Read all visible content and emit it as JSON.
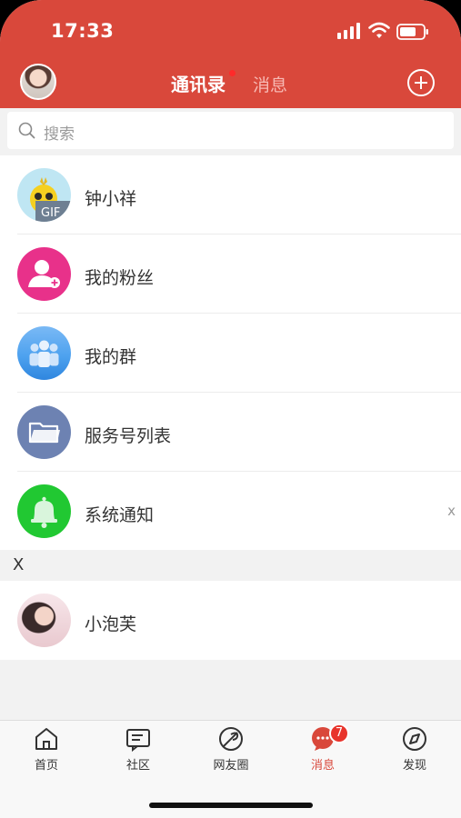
{
  "status_bar": {
    "time": "17:33"
  },
  "header": {
    "tab_contacts": "通讯录",
    "tab_messages": "消息"
  },
  "search": {
    "placeholder": "搜索"
  },
  "rows": [
    {
      "label": "钟小祥",
      "icon": "gif-avatar-icon",
      "badge_text": "GIF",
      "color": "#bfe6f3"
    },
    {
      "label": "我的粉丝",
      "icon": "followers-icon",
      "color": "#e8318a"
    },
    {
      "label": "我的群",
      "icon": "groups-icon",
      "color": "#4ea2ef"
    },
    {
      "label": "服务号列表",
      "icon": "folder-icon",
      "color": "#6d82b2"
    },
    {
      "label": "系统通知",
      "icon": "bell-icon",
      "color": "#21c832",
      "close_mark": "x"
    }
  ],
  "section": {
    "title": "X"
  },
  "contacts": [
    {
      "label": "小泡芙",
      "icon": "contact-avatar"
    }
  ],
  "tabbar": {
    "items": [
      {
        "label": "首页",
        "icon": "home-icon"
      },
      {
        "label": "社区",
        "icon": "community-icon"
      },
      {
        "label": "网友圈",
        "icon": "moments-icon"
      },
      {
        "label": "消息",
        "icon": "messages-icon",
        "badge": "7",
        "active": true
      },
      {
        "label": "发现",
        "icon": "compass-icon"
      }
    ]
  },
  "colors": {
    "brand": "#d9483b",
    "badge": "#e8342c"
  }
}
